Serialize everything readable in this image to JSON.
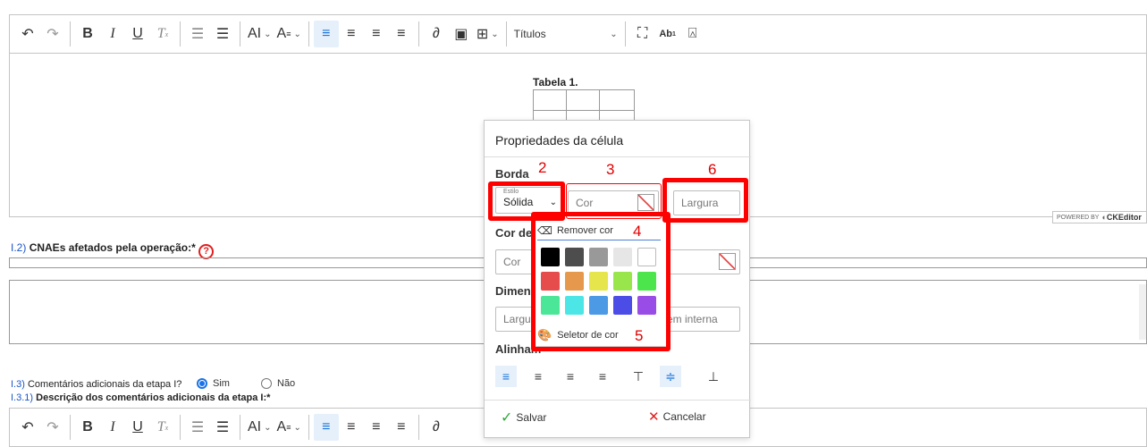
{
  "toolbar": {
    "heading_label": "Títulos",
    "items": [
      "undo-icon",
      "redo-icon",
      "bold-icon",
      "italic-icon",
      "underline-icon",
      "remove-format-icon",
      "outdent-icon",
      "indent-icon",
      "font-size-icon",
      "font-family-icon",
      "align-left-icon",
      "align-center-icon",
      "align-right-icon",
      "align-justify-icon",
      "link-icon",
      "insert-image-icon",
      "insert-table-icon",
      "heading-dropdown",
      "fullscreen-icon",
      "special-chars-icon",
      "paint-bucket-icon"
    ]
  },
  "editor": {
    "table_caption": "Tabela 1.",
    "powered_by": "POWERED BY",
    "ckeditor_brand": "CKEditor"
  },
  "form": {
    "q12_num": "I.2)",
    "q12_label": "CNAEs afetados pela operação:*",
    "q13_num": "I.3)",
    "q13_label": "Comentários adicionais da etapa I?",
    "q13_sim": "Sim",
    "q13_nao": "Não",
    "q13_selected": "Sim",
    "q131_num": "I.3.1)",
    "q131_label": "Descrição dos comentários adicionais da etapa I:*"
  },
  "panel": {
    "title": "Propriedades da célula",
    "borda_label": "Borda",
    "estilo_label": "Estilo",
    "estilo_value": "Sólida",
    "cor_placeholder": "Cor",
    "largura_placeholder": "Largura",
    "cor_de_label": "Cor de",
    "cor2_placeholder": "Cor",
    "dimens_label": "Dimens",
    "largura2_placeholder": "Largur",
    "margem_placeholder": "em interna",
    "alinhamento_label": "Alinham",
    "remover_cor": "Remover cor",
    "seletor_cor": "Seletor de cor",
    "salvar": "Salvar",
    "cancelar": "Cancelar"
  },
  "palette": {
    "colors": [
      "#000000",
      "#4d4d4d",
      "#999999",
      "#e6e6e6",
      "#ffffff",
      "#e64c4c",
      "#e6994c",
      "#e6e64c",
      "#99e64c",
      "#4ce64c",
      "#4ce699",
      "#4ce6e6",
      "#4c99e6",
      "#4c4ce6",
      "#994ce6"
    ]
  },
  "annotations": {
    "n2": "2",
    "n3": "3",
    "n4": "4",
    "n5": "5",
    "n6": "6",
    "color": "#ff0000"
  }
}
